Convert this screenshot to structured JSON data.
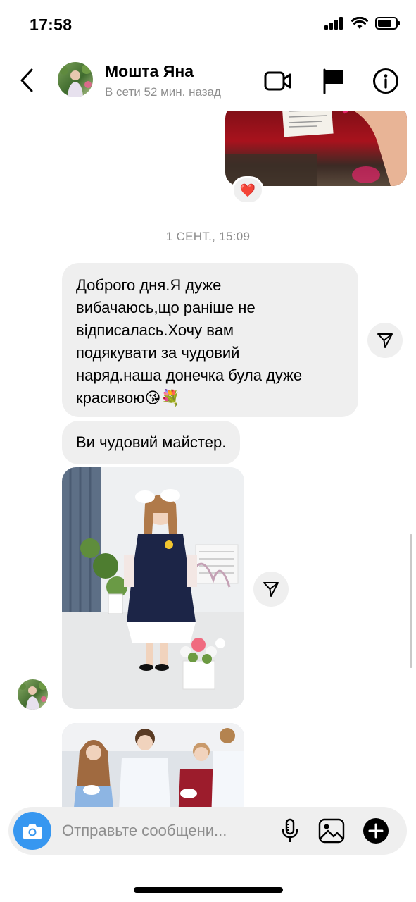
{
  "status_bar": {
    "time": "17:58"
  },
  "header": {
    "contact_name": "Мошта Яна",
    "contact_status": "В сети 52 мин. назад",
    "icons": [
      "back-icon",
      "video-call-icon",
      "flag-icon",
      "info-icon"
    ]
  },
  "conversation": {
    "reaction_emoji": "❤️",
    "timestamp": "1 СЕНТ., 15:09",
    "messages": [
      {
        "lines": [
          "Доброго дня.Я дуже",
          "вибачаюсь,що раніше не",
          "відписалась.Хочу вам",
          "подякувати за чудовий",
          "наряд.наша донечка була дуже",
          "красивою😘💐"
        ]
      },
      {
        "lines": [
          "Ви чудовий майстер."
        ]
      }
    ],
    "attachments": [
      "photo-girl-school-uniform",
      "photo-group-students"
    ]
  },
  "composer": {
    "placeholder": "Отправьте сообщени...",
    "icons": [
      "camera-icon",
      "microphone-icon",
      "gallery-icon",
      "plus-icon"
    ]
  },
  "colors": {
    "accent": "#3797f0",
    "bubble": "#efefef",
    "muted_text": "#8e8e8e",
    "heart": "#e0243a"
  }
}
